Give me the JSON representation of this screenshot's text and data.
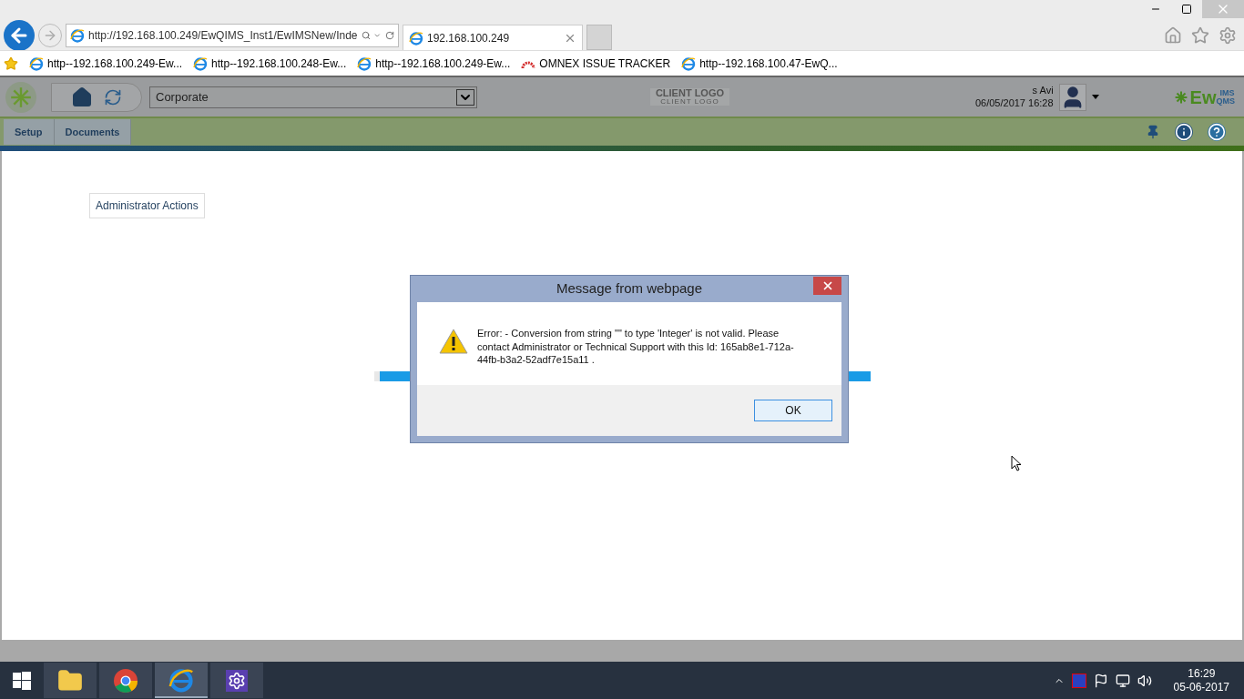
{
  "browser": {
    "address": "http://192.168.100.249/EwQIMS_Inst1/EwIMSNew/Inde",
    "tabs": [
      {
        "label": "192.168.100.249",
        "selected": true
      }
    ],
    "favorites": [
      {
        "label": "http--192.168.100.249-Ew...",
        "kind": "page"
      },
      {
        "label": "http--192.168.100.248-Ew...",
        "kind": "page"
      },
      {
        "label": "http--192.168.100.249-Ew...",
        "kind": "page"
      },
      {
        "label": "OMNEX ISSUE TRACKER",
        "kind": "tracker"
      },
      {
        "label": "http--192.168.100.47-EwQ...",
        "kind": "page"
      }
    ]
  },
  "app": {
    "site_select": {
      "value": "Corporate"
    },
    "client_logo": "CLIENT LOGO",
    "client_logo_sub": "CLIENT LOGO",
    "user": "s Avi",
    "datetime": "06/05/2017 16:28",
    "brand": {
      "main": "Ew",
      "top": "IMS",
      "bottom": "QMS"
    },
    "menu": [
      {
        "label": "Setup"
      },
      {
        "label": "Documents"
      }
    ],
    "link": "Administrator Actions"
  },
  "loading_bar": {
    "level": 1
  },
  "dialog": {
    "title": "Message from webpage",
    "message": "Error: - Conversion from string \"\" to type 'Integer' is not valid. Please contact Administrator or Technical Support with this Id: 165ab8e1-712a-44fb-b3a2-52adf7e15a11 .",
    "button": "OK"
  },
  "taskbar": {
    "apps": [
      {
        "kind": "explorer",
        "active": false
      },
      {
        "kind": "chrome",
        "active": false
      },
      {
        "kind": "ie",
        "active": true
      },
      {
        "kind": "settings",
        "active": false
      }
    ],
    "time": "16:29",
    "date": "05-06-2017"
  }
}
